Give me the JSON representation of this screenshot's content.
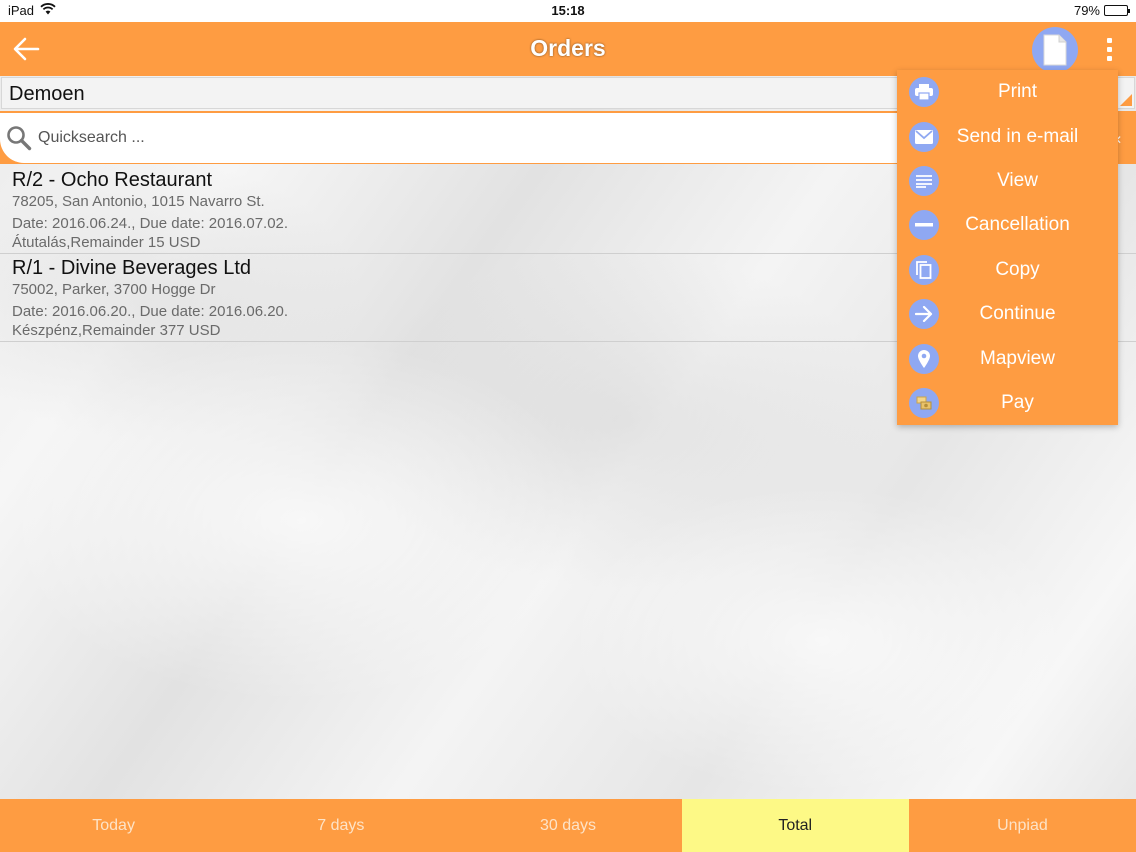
{
  "status_bar": {
    "device": "iPad",
    "time": "15:18",
    "battery": "79%",
    "battery_level": 0.79
  },
  "header": {
    "title": "Orders"
  },
  "company_select": {
    "value": "Demoen"
  },
  "search": {
    "placeholder": "Quicksearch ..."
  },
  "orders": [
    {
      "title": "R/2 -  Ocho Restaurant",
      "address": "78205, San Antonio, 1015 Navarro St.",
      "dates": "Date: 2016.06.24., Due date: 2016.07.02.",
      "payment": "Átutalás,Remainder 15 USD"
    },
    {
      "title": "R/1 -  Divine Beverages Ltd",
      "address": "75002, Parker, 3700 Hogge Dr",
      "dates": "Date: 2016.06.20., Due date: 2016.06.20.",
      "payment": "Készpénz,Remainder 377 USD"
    }
  ],
  "menu": {
    "items": [
      {
        "label": "Print",
        "icon": "printer-icon"
      },
      {
        "label": "Send in e-mail",
        "icon": "mail-icon"
      },
      {
        "label": "View",
        "icon": "list-icon"
      },
      {
        "label": "Cancellation",
        "icon": "minus-icon"
      },
      {
        "label": "Copy",
        "icon": "copy-icon"
      },
      {
        "label": "Continue",
        "icon": "arrow-right-icon"
      },
      {
        "label": "Mapview",
        "icon": "map-pin-icon"
      },
      {
        "label": "Pay",
        "icon": "cash-icon"
      }
    ]
  },
  "tabs": [
    {
      "label": "Today"
    },
    {
      "label": "7 days"
    },
    {
      "label": "30 days"
    },
    {
      "label": "Total",
      "active": true
    },
    {
      "label": "Unpiad"
    }
  ],
  "colors": {
    "accent": "#fe9c42",
    "icon_circle": "#8fa8f2",
    "active_tab": "#fdf986"
  }
}
